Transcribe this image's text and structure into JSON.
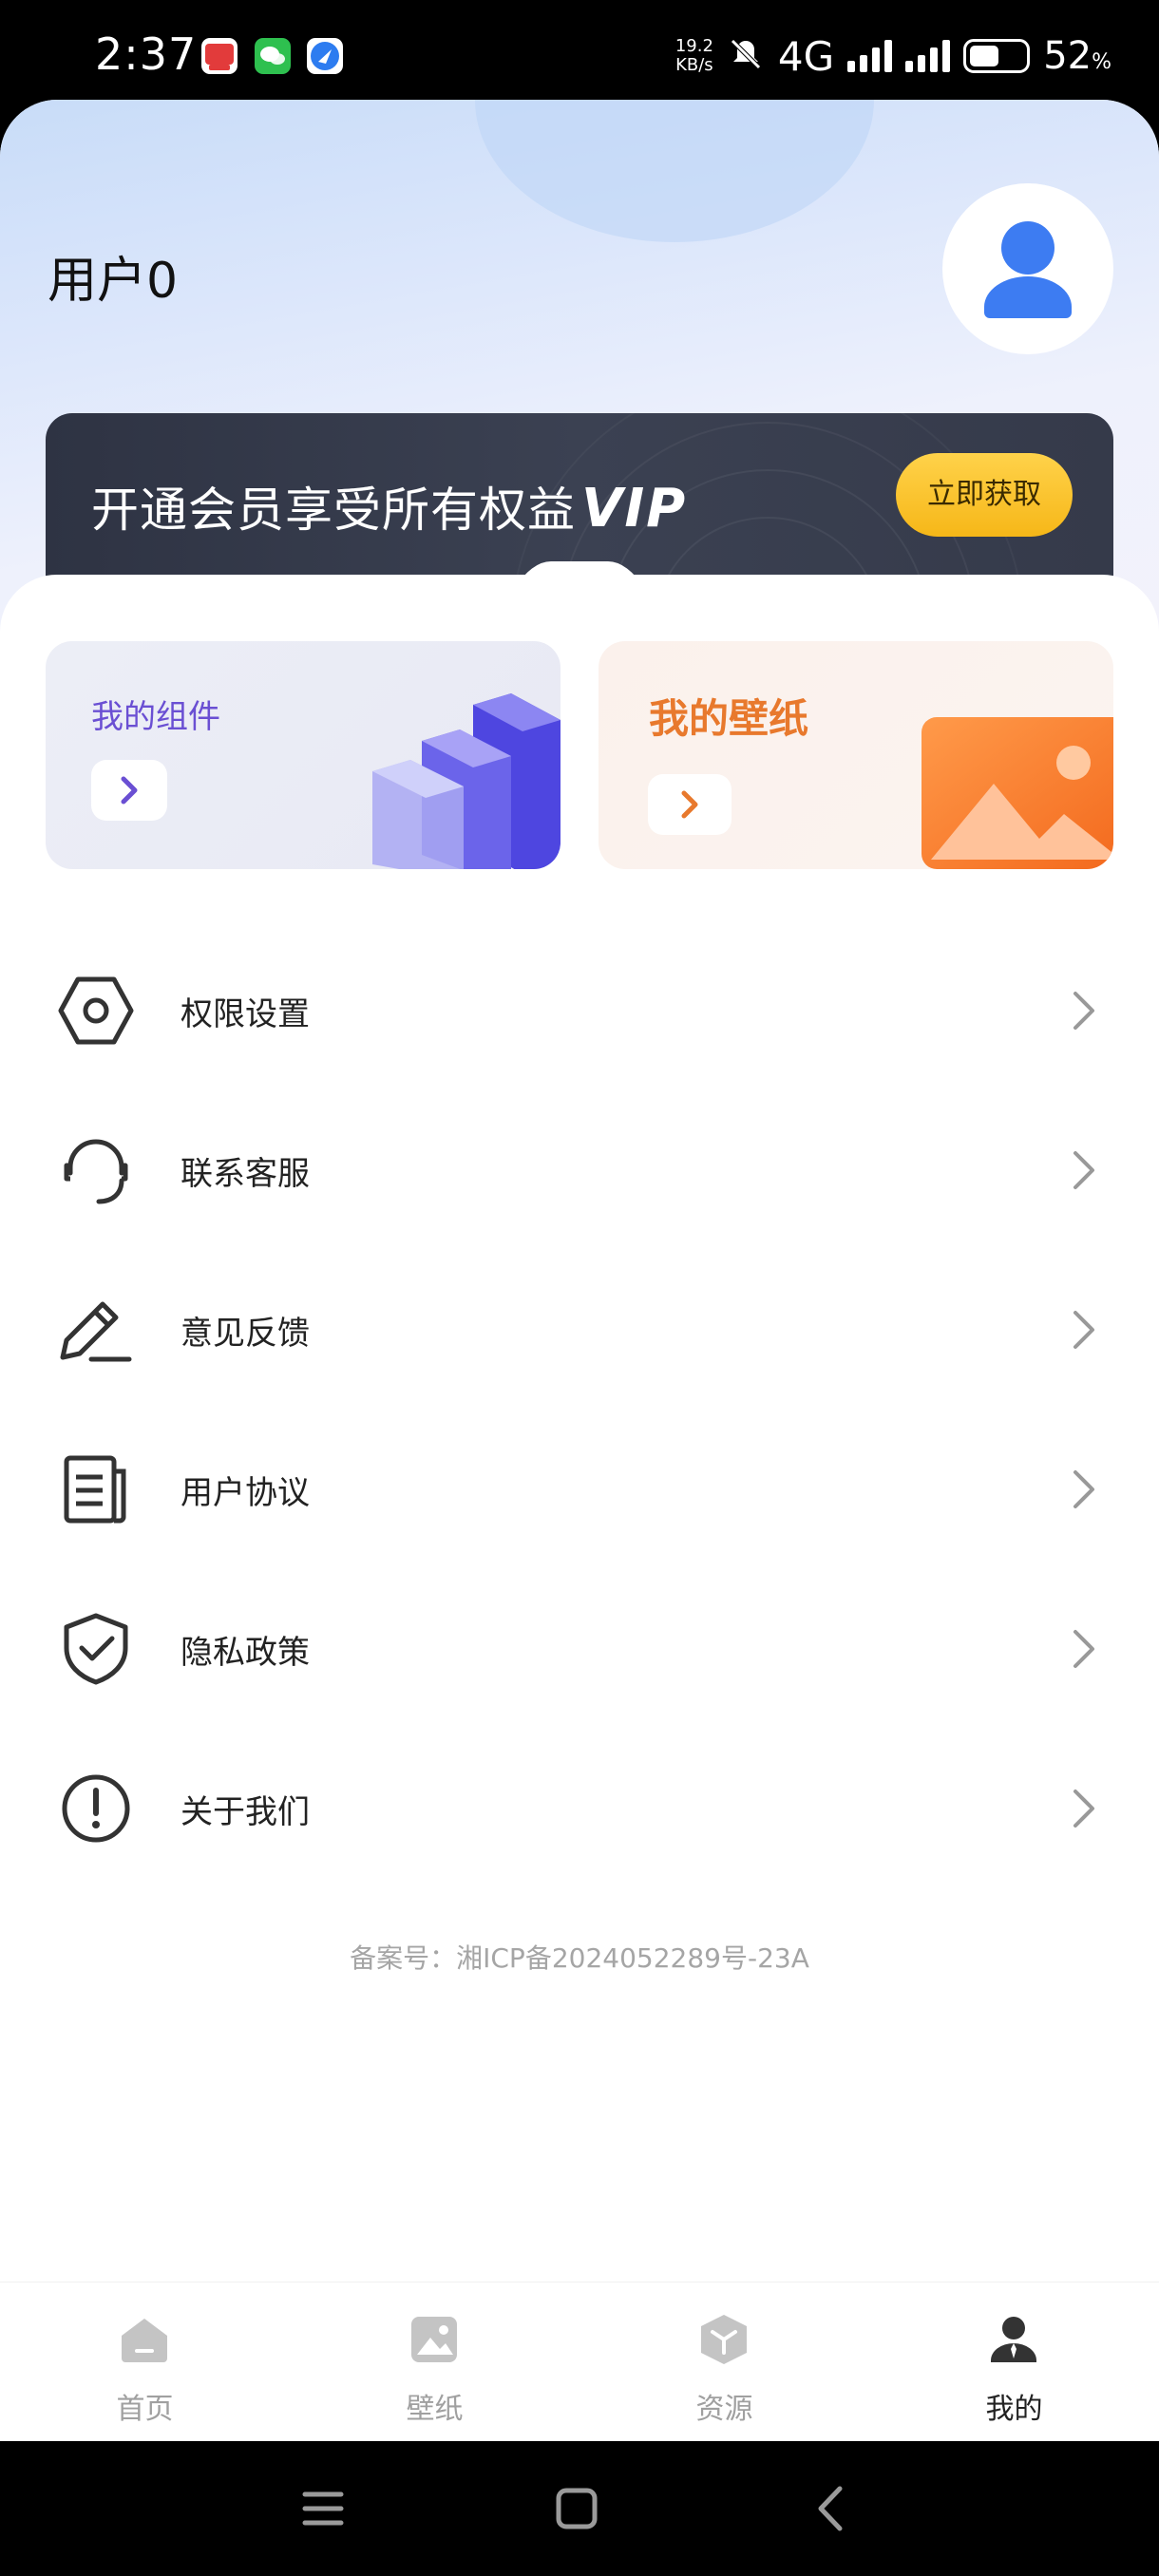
{
  "status_bar": {
    "time": "2:37",
    "net_speed_value": "19.2",
    "net_speed_unit": "KB/s",
    "network": "4G",
    "battery_percent": "52",
    "battery_unit": "%"
  },
  "profile": {
    "username": "用户0"
  },
  "vip_banner": {
    "text": "开通会员享受所有权益",
    "badge": "VIP",
    "button_label": "立即获取"
  },
  "cards": {
    "widgets_title": "我的组件",
    "wallpapers_title": "我的壁纸"
  },
  "menu": [
    {
      "label": "权限设置",
      "icon": "hexagon-settings-icon"
    },
    {
      "label": "联系客服",
      "icon": "headset-icon"
    },
    {
      "label": "意见反馈",
      "icon": "pencil-icon"
    },
    {
      "label": "用户协议",
      "icon": "document-icon"
    },
    {
      "label": "隐私政策",
      "icon": "shield-check-icon"
    },
    {
      "label": "关于我们",
      "icon": "exclamation-circle-icon"
    }
  ],
  "footer": {
    "icp": "备案号：湘ICP备2024052289号-23A"
  },
  "tabs": [
    {
      "label": "首页",
      "icon": "home-icon",
      "active": false
    },
    {
      "label": "壁纸",
      "icon": "image-icon",
      "active": false
    },
    {
      "label": "资源",
      "icon": "cube-icon",
      "active": false
    },
    {
      "label": "我的",
      "icon": "person-icon",
      "active": true
    }
  ],
  "colors": {
    "accent_purple": "#6a4fd3",
    "accent_orange": "#e8792d",
    "vip_button": "#f6b718",
    "avatar_blue": "#3d7cf2"
  }
}
